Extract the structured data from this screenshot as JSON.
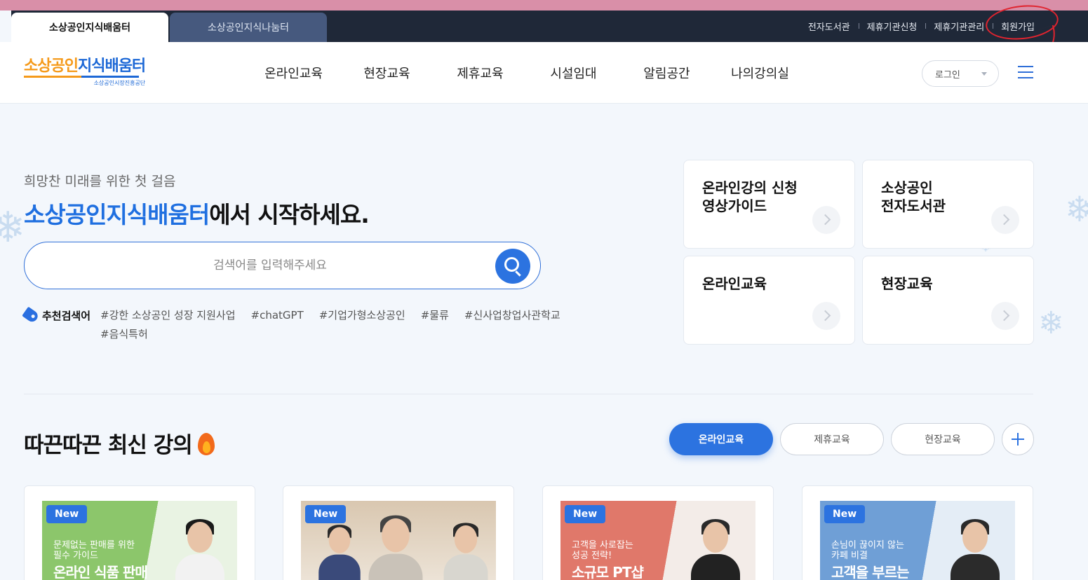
{
  "site_tabs": [
    {
      "label": "소상공인지식배움터",
      "active": true
    },
    {
      "label": "소상공인지식나눔터",
      "active": false
    }
  ],
  "utility_links": [
    "전자도서관",
    "제휴기관신청",
    "제휴기관관리",
    "회원가입"
  ],
  "logo": {
    "title_orange": "소상공인",
    "title_blue": "지식배움터",
    "subtitle": "소상공인시장진흥공단"
  },
  "gnb": [
    "온라인교육",
    "현장교육",
    "제휴교육",
    "시설임대",
    "알림공간",
    "나의강의실"
  ],
  "login_select": {
    "value": "로그인"
  },
  "hero": {
    "subtitle": "희망찬 미래를 위한 첫 걸음",
    "title_brand": "소상공인지식배움터",
    "title_rest": "에서 시작하세요."
  },
  "search": {
    "placeholder": "검색어를 입력해주세요",
    "value": ""
  },
  "recommend": {
    "label": "추천검색어",
    "tags": [
      "#강한 소상공인 성장 지원사업",
      "#chatGPT",
      "#기업가형소상공인",
      "#물류",
      "#신사업창업사관학교",
      "#음식특허"
    ]
  },
  "quick_links": [
    {
      "title": "온라인강의 신청\n영상가이드"
    },
    {
      "title": "소상공인\n전자도서관"
    },
    {
      "title": "온라인교육"
    },
    {
      "title": "현장교육"
    }
  ],
  "latest": {
    "title": "따끈따끈 최신 강의",
    "filters": [
      {
        "label": "온라인교육",
        "active": true
      },
      {
        "label": "제휴교육",
        "active": false
      },
      {
        "label": "현장교육",
        "active": false
      }
    ]
  },
  "courses": [
    {
      "badge": "New",
      "subtitle": "문제없는 판매를 위한\n필수 가이드",
      "title": "온라인 식품 판매",
      "bg_from": "#8cc66b",
      "bg_to": "#e9f3e3"
    },
    {
      "badge": "New",
      "subtitle": "",
      "title": "",
      "bg_from": "#d9c7b0",
      "bg_to": "#efe7dc"
    },
    {
      "badge": "New",
      "subtitle": "고객을 사로잡는\n성공 전략!",
      "title": "소규모 PT샵",
      "bg_from": "#e0786a",
      "bg_to": "#f3ece8"
    },
    {
      "badge": "New",
      "subtitle": "손님이 끊이지 않는\n카페 비결",
      "title": "고객을 부르는",
      "bg_from": "#6f9fd6",
      "bg_to": "#e4edf6"
    }
  ],
  "colors": {
    "primary": "#2c73e0",
    "topbar": "#1f2838",
    "accent_orange": "#f59a1b"
  }
}
